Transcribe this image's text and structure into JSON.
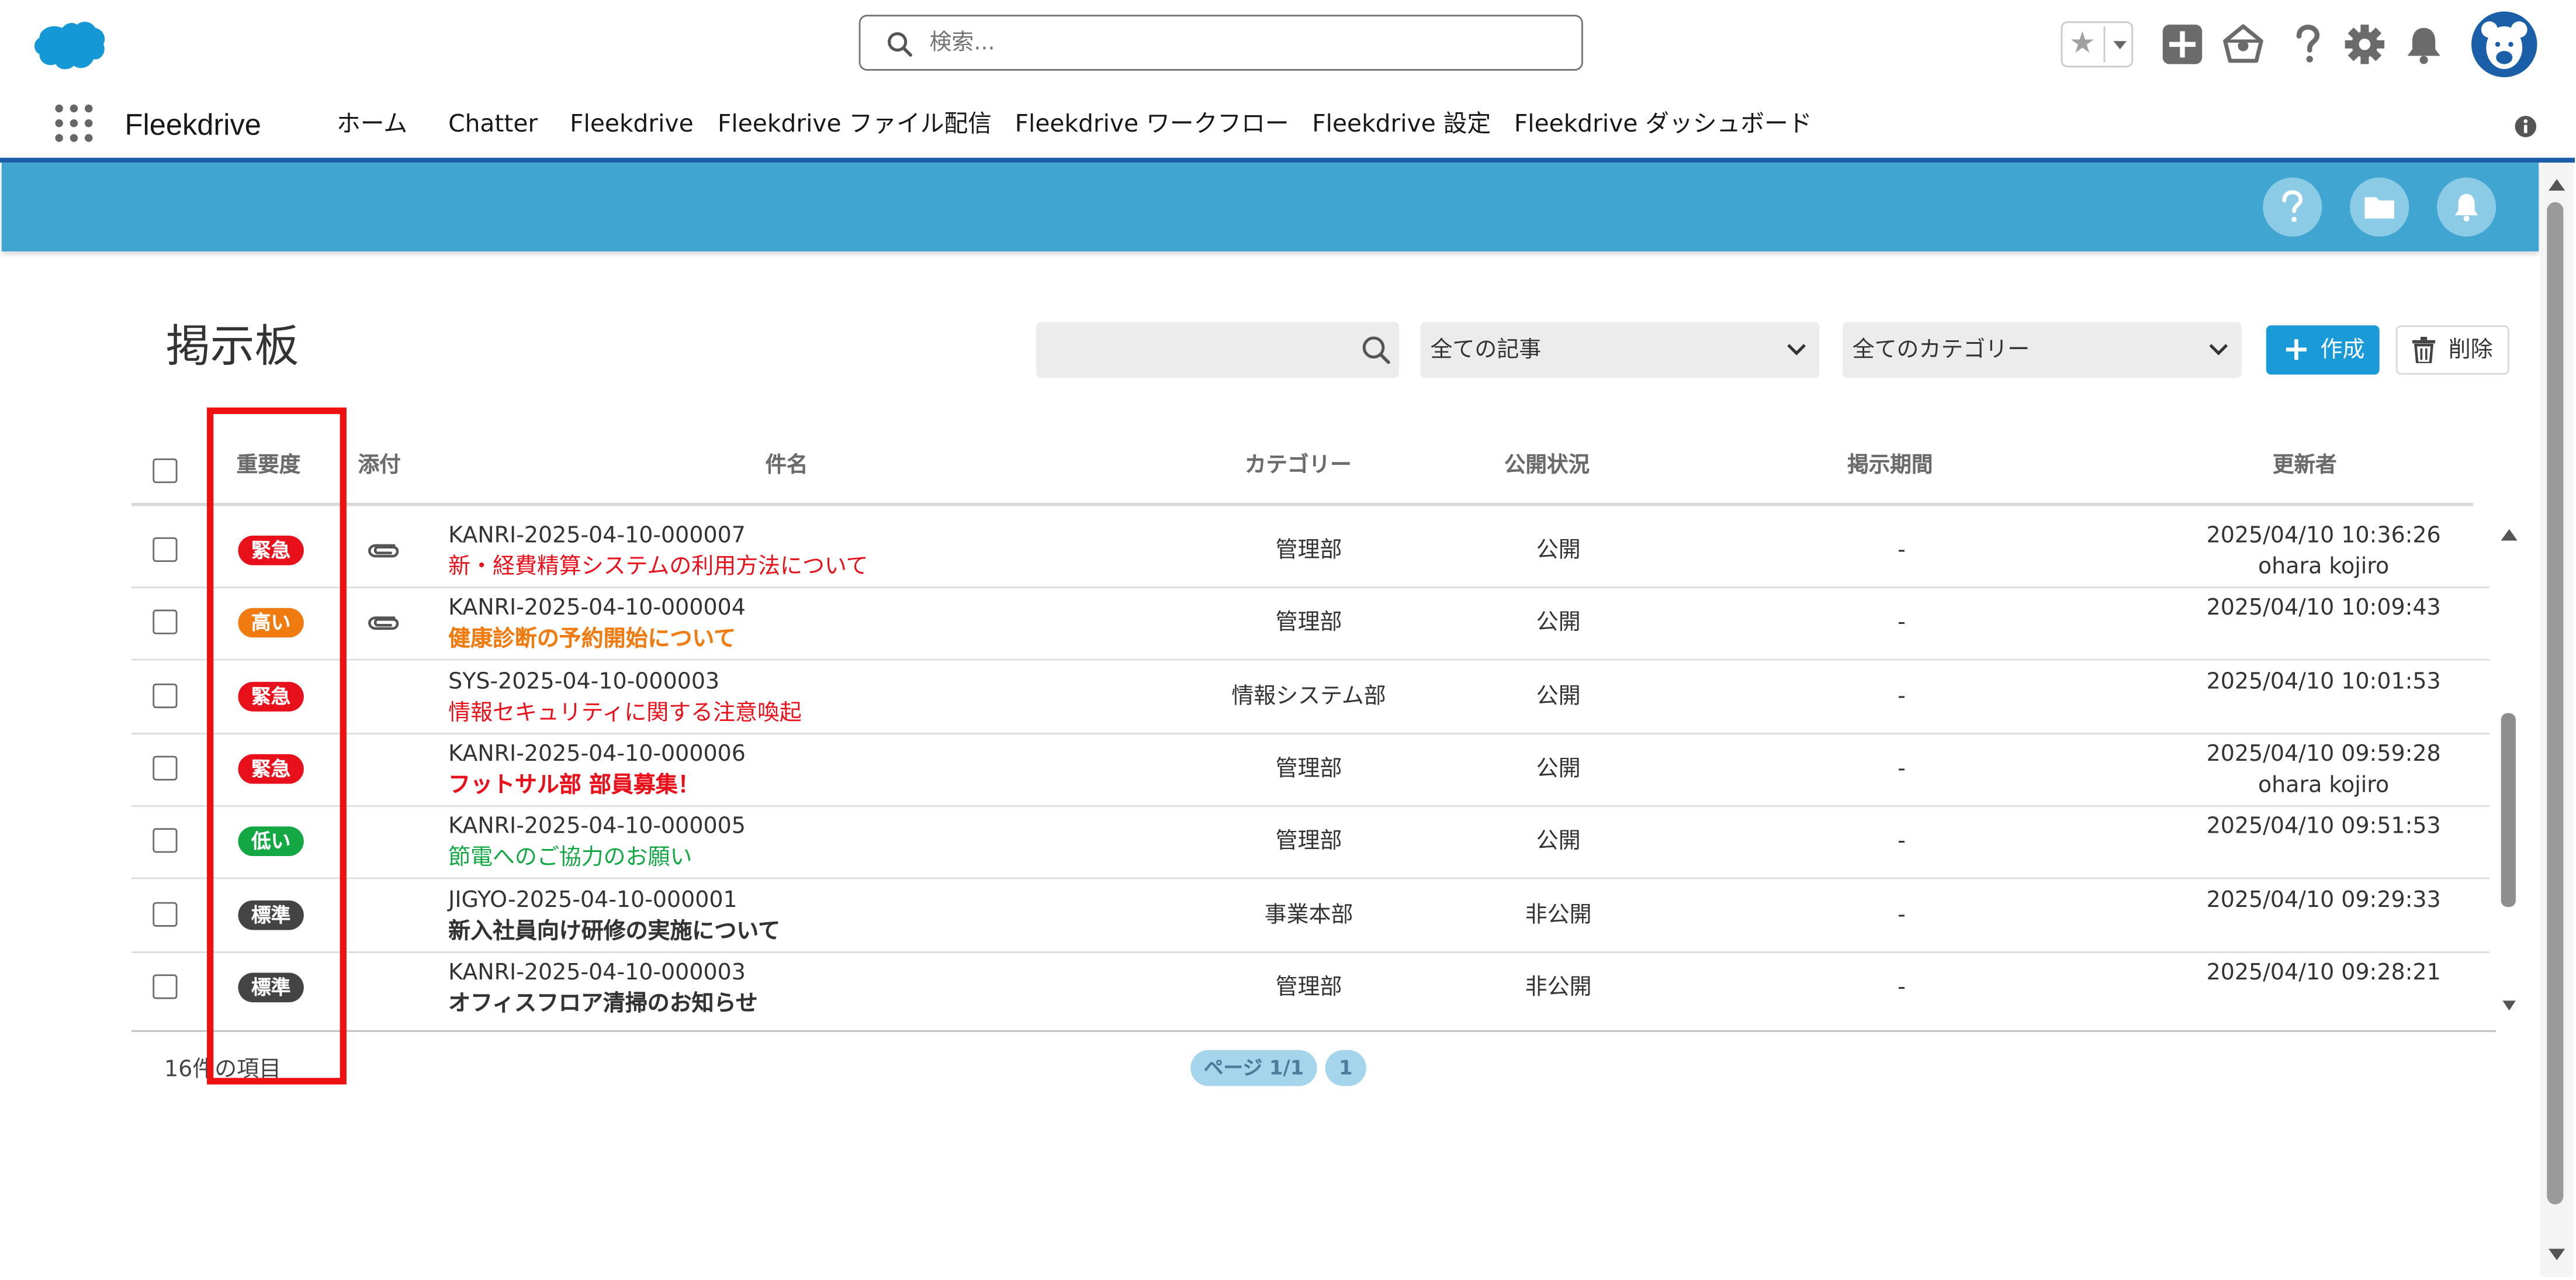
{
  "header": {
    "search_placeholder": "検索..."
  },
  "nav": {
    "app_name": "Fleekdrive",
    "items": [
      "ホーム",
      "Chatter",
      "Fleekdrive",
      "Fleekdrive ファイル配信",
      "Fleekdrive ワークフロー",
      "Fleekdrive 設定",
      "Fleekdrive ダッシュボード"
    ]
  },
  "page": {
    "title": "掲示板",
    "filter_articles": "全ての記事",
    "filter_categories": "全てのカテゴリー",
    "create_label": "作成",
    "delete_label": "削除"
  },
  "table": {
    "headers": {
      "importance": "重要度",
      "attachment": "添付",
      "subject": "件名",
      "category": "カテゴリー",
      "status": "公開状況",
      "period": "掲示期間",
      "updater": "更新者"
    },
    "rows": [
      {
        "importance": "緊急",
        "badge_color": "#e8101a",
        "attach": true,
        "doc_no": "KANRI-2025-04-10-000007",
        "subject": "新・経費精算システムの利用方法について",
        "subject_color": "#e8101a",
        "subject_bold": false,
        "category": "管理部",
        "status": "公開",
        "period": "-",
        "updated": "2025/04/10 10:36:26",
        "updater": "ohara kojiro"
      },
      {
        "importance": "高い",
        "badge_color": "#f07b10",
        "attach": true,
        "doc_no": "KANRI-2025-04-10-000004",
        "subject": "健康診断の予約開始について",
        "subject_color": "#f07b10",
        "subject_bold": true,
        "category": "管理部",
        "status": "公開",
        "period": "-",
        "updated": "2025/04/10 10:09:43",
        "updater": ""
      },
      {
        "importance": "緊急",
        "badge_color": "#e8101a",
        "attach": false,
        "doc_no": "SYS-2025-04-10-000003",
        "subject": "情報セキュリティに関する注意喚起",
        "subject_color": "#e8101a",
        "subject_bold": false,
        "category": "情報システム部",
        "status": "公開",
        "period": "-",
        "updated": "2025/04/10 10:01:53",
        "updater": ""
      },
      {
        "importance": "緊急",
        "badge_color": "#e8101a",
        "attach": false,
        "doc_no": "KANRI-2025-04-10-000006",
        "subject": "フットサル部 部員募集！",
        "subject_color": "#e8101a",
        "subject_bold": true,
        "category": "管理部",
        "status": "公開",
        "period": "-",
        "updated": "2025/04/10 09:59:28",
        "updater": "ohara kojiro"
      },
      {
        "importance": "低い",
        "badge_color": "#14a845",
        "attach": false,
        "doc_no": "KANRI-2025-04-10-000005",
        "subject": "節電へのご協力のお願い",
        "subject_color": "#14a845",
        "subject_bold": false,
        "category": "管理部",
        "status": "公開",
        "period": "-",
        "updated": "2025/04/10 09:51:53",
        "updater": ""
      },
      {
        "importance": "標準",
        "badge_color": "#444444",
        "attach": false,
        "doc_no": "JIGYO-2025-04-10-000001",
        "subject": "新入社員向け研修の実施について",
        "subject_color": "#333333",
        "subject_bold": true,
        "category": "事業本部",
        "status": "非公開",
        "period": "-",
        "updated": "2025/04/10 09:29:33",
        "updater": ""
      },
      {
        "importance": "標準",
        "badge_color": "#444444",
        "attach": false,
        "doc_no": "KANRI-2025-04-10-000003",
        "subject": "オフィスフロア清掃のお知らせ",
        "subject_color": "#333333",
        "subject_bold": true,
        "category": "管理部",
        "status": "非公開",
        "period": "-",
        "updated": "2025/04/10 09:28:21",
        "updater": ""
      }
    ]
  },
  "footer": {
    "count": "16件の項目",
    "page_label": "ページ 1/1",
    "page_number": "1"
  },
  "colors": {
    "brand_blue": "#1b5fa8",
    "banner": "#41a5d1",
    "create_button": "#1a9bd7",
    "highlight": "#ee1111"
  }
}
